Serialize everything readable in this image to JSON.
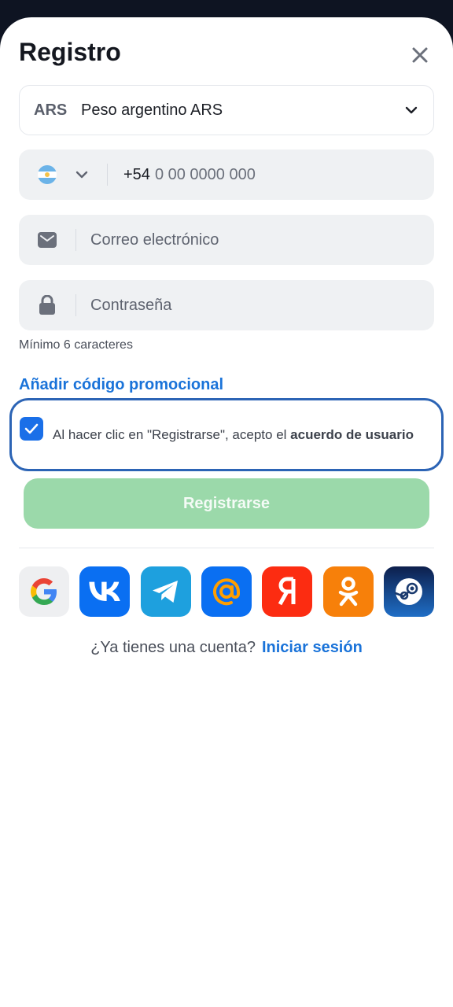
{
  "dialog": {
    "title": "Registro"
  },
  "currency": {
    "code": "ARS",
    "name": "Peso argentino ARS"
  },
  "phone": {
    "prefix": "+54",
    "mask": "0 00 0000 000"
  },
  "email": {
    "placeholder": "Correo electrónico"
  },
  "password": {
    "placeholder": "Contraseña",
    "hint": "Mínimo 6 caracteres"
  },
  "promo": {
    "label": "Añadir código promocional"
  },
  "agreement": {
    "checked": true,
    "text": "Al hacer clic en \"Registrarse\", acepto el ",
    "link": "acuerdo de usuario"
  },
  "submit": {
    "label": "Registrarse"
  },
  "socials": [
    "google",
    "vk",
    "telegram",
    "mail",
    "yandex",
    "odnoklassniki",
    "steam"
  ],
  "login": {
    "question": "¿Ya tienes una cuenta?",
    "link": "Iniciar sesión"
  },
  "colors": {
    "accent": "#1a73d9",
    "submit_disabled": "#9bd9aa",
    "checkbox": "#1a6fe8",
    "focus_border": "#2c64b5"
  }
}
